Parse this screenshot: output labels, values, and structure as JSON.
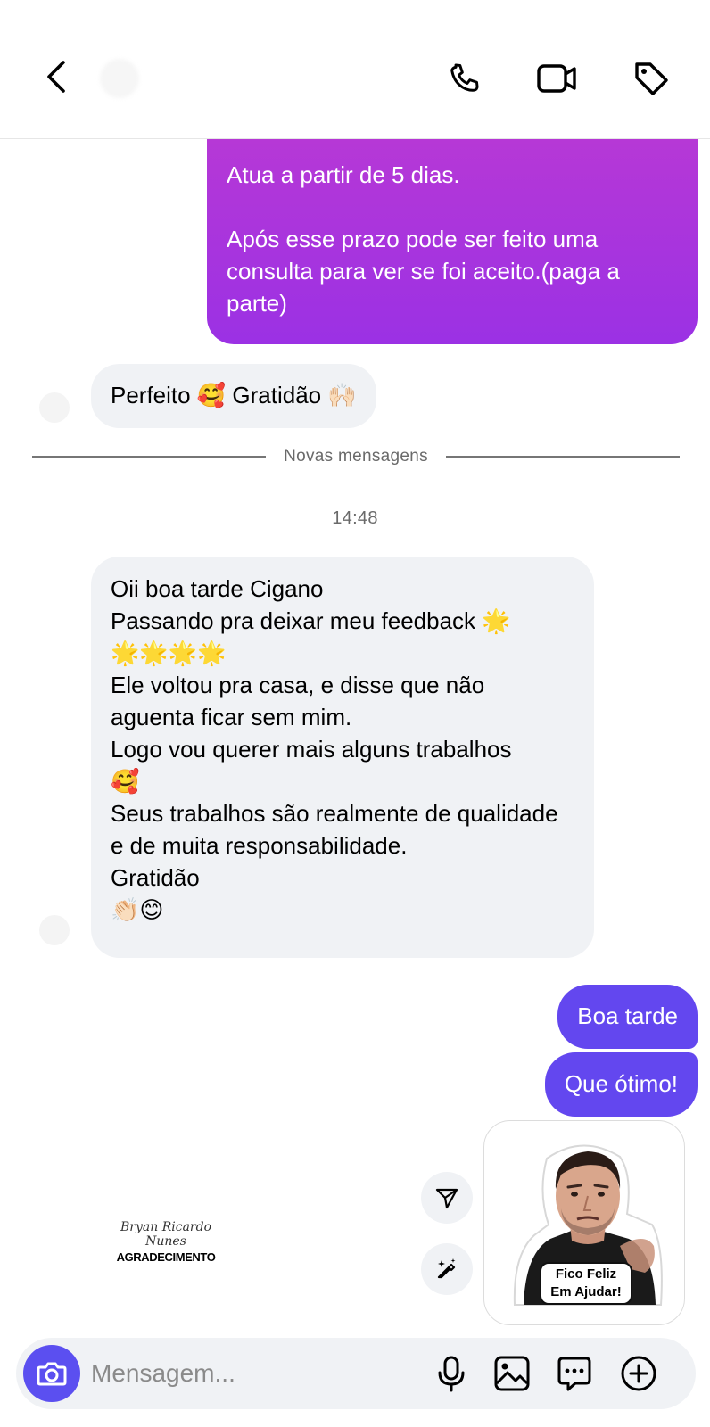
{
  "header": {
    "back": "back",
    "icons": [
      "chevron-left-icon",
      "phone-icon",
      "video-camera-icon",
      "tag-icon"
    ]
  },
  "messages": {
    "outgoing_first": {
      "para1": "Atua a partir de 5 dias.",
      "para2": "Após esse prazo pode ser feito uma consulta para ver se foi aceito.(paga a parte)"
    },
    "incoming_short": "Perfeito 🥰  Gratidão 🙌🏻",
    "divider_label": "Novas mensagens",
    "timestamp": "14:48",
    "incoming_long": {
      "l1": "Oii boa tarde Cigano",
      "l2": "Passando pra deixar meu feedback 🌟",
      "l3": "🌟🌟🌟🌟",
      "l4": "Ele voltou pra casa, e disse que não aguenta ficar sem mim.",
      "l5": "Logo vou querer mais alguns trabalhos",
      "l6": "🥰",
      "l7": "Seus trabalhos são realmente de qualidade e de muita responsabilidade.",
      "l8": "Gratidão",
      "l9": "👏🏻😊"
    },
    "outgoing_reply1": "Boa tarde",
    "outgoing_reply2": "Que ótimo!"
  },
  "shared_image": {
    "name_line1": "Bryan Ricardo",
    "name_line2": "Nunes",
    "caption": "AGRADECIMENTO"
  },
  "sticker": {
    "line1": "Fico Feliz",
    "line2": "Em Ajudar!"
  },
  "composer": {
    "placeholder": "Mensagem..."
  },
  "colors": {
    "outgoing_purple": "#a934dc",
    "outgoing_blue": "#6347ef",
    "incoming_bg": "#f0f2f5",
    "camera_button": "#5b4ff0"
  }
}
